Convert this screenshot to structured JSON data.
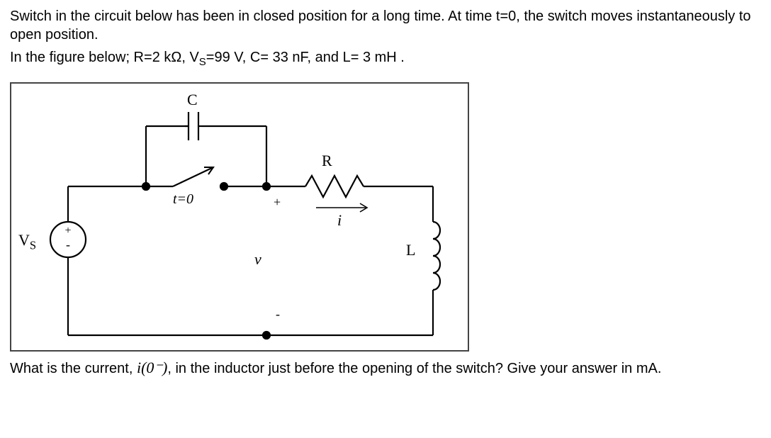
{
  "problem": {
    "line1": "Switch in the circuit below has been in closed position for a long time. At time t=0, the switch moves instantaneously to open position.",
    "line2_prefix": "In the figure below; R=",
    "R_val": "2 kΩ",
    "Vs_prefix": ", V",
    "Vs_sub": "S",
    "Vs_eq": "=",
    "Vs_val": "99 V",
    "C_prefix": ", C= ",
    "C_val": "33 nF",
    "L_prefix": ",  and L= ",
    "L_val": "3 mH",
    "line2_suffix": " ."
  },
  "labels": {
    "C": "C",
    "R": "R",
    "L": "L",
    "Vs": "V",
    "Vs_sub": "S",
    "t0": "t=0",
    "plus": "+",
    "minus_small": "-",
    "v": "v",
    "i": "i",
    "dash": "-"
  },
  "question": {
    "q_prefix": "What is the current, ",
    "q_sym": "i(0⁻)",
    "q_suffix": ", in the inductor just before the opening of the switch? Give your answer in mA."
  }
}
